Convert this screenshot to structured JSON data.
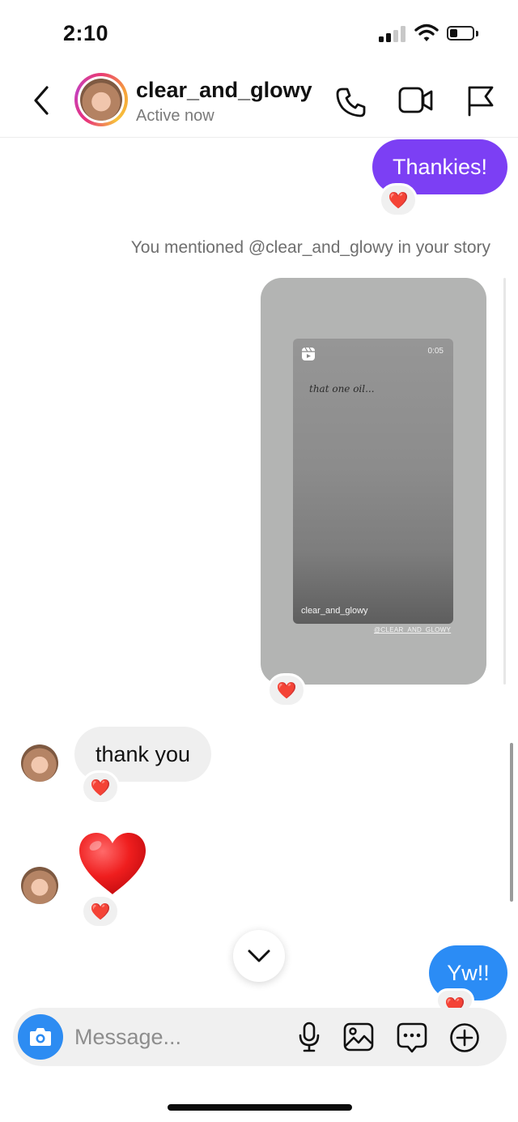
{
  "status_bar": {
    "time": "2:10"
  },
  "header": {
    "username": "clear_and_glowy",
    "status": "Active now",
    "icons": [
      "back-icon",
      "phone-icon",
      "video-icon",
      "flag-icon"
    ]
  },
  "messages": {
    "sent_1": {
      "text": "Thankies!",
      "reaction": "❤️"
    },
    "system": "You mentioned @clear_and_glowy in your story",
    "story": {
      "caption": "that one oil...",
      "duration": "0:05",
      "user": "clear_and_glowy",
      "watermark": "@CLEAR_AND_GLOWY",
      "reaction": "❤️"
    },
    "received_1": {
      "text": "thank you",
      "reaction": "❤️"
    },
    "received_2": {
      "text": "❤️",
      "reaction": "❤️"
    },
    "sent_2": {
      "text": "Yw!!",
      "reaction": "❤️"
    }
  },
  "composer": {
    "placeholder": "Message...",
    "icons": [
      "camera-icon",
      "microphone-icon",
      "gallery-icon",
      "sticker-icon",
      "plus-icon"
    ]
  },
  "colors": {
    "sent_purple": "#7c3ff4",
    "sent_blue": "#2b8cf5",
    "received_gray": "#efefef",
    "camera_blue": "#2d8cf2"
  }
}
